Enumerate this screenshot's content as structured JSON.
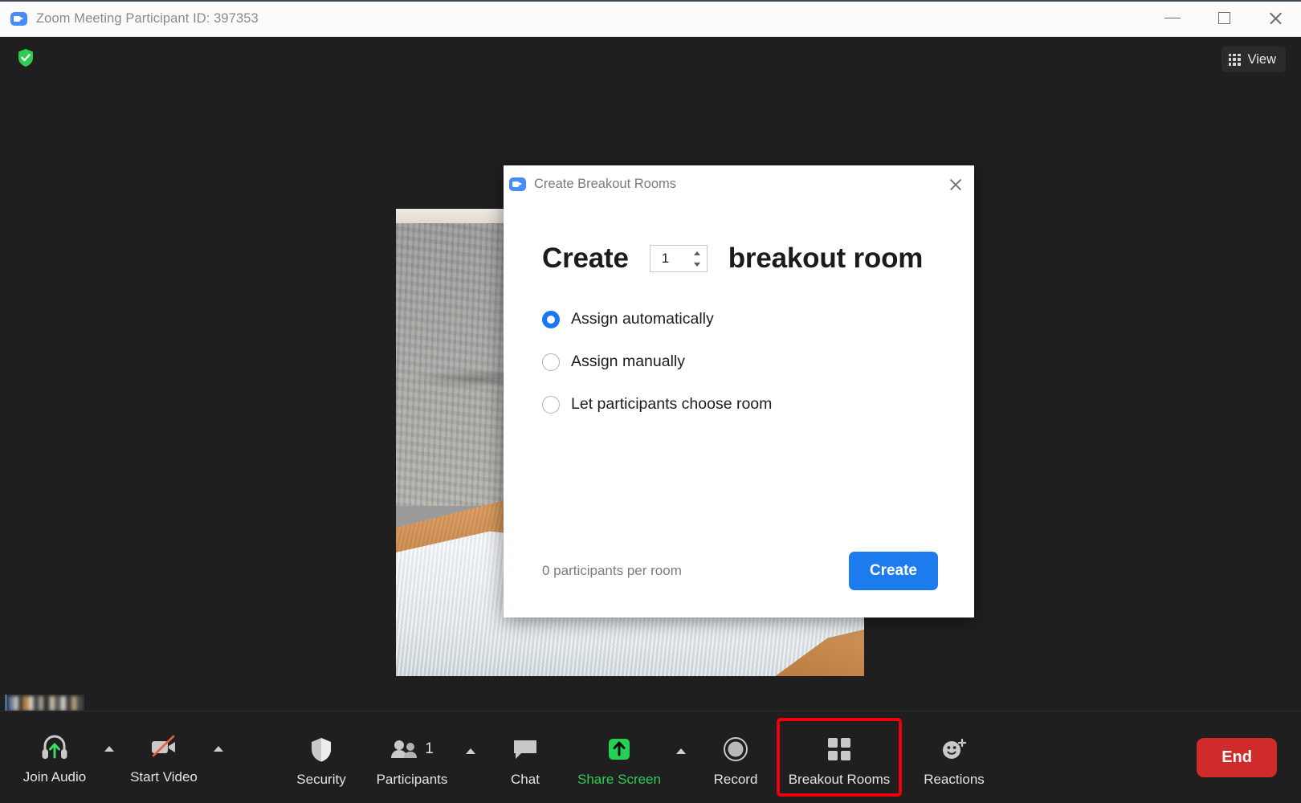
{
  "window": {
    "title": "Zoom Meeting Participant ID: 397353",
    "app_icon": "zoom-camera-icon",
    "controls": {
      "minimize": "minimize-icon",
      "maximize": "maximize-icon",
      "close": "close-icon"
    }
  },
  "stage": {
    "encryption_badge": "green-shield-check-icon",
    "view_button": {
      "label": "View",
      "icon": "grid-view-icon"
    },
    "self_name_label": "(blurred participant name)"
  },
  "dialog": {
    "title": "Create Breakout Rooms",
    "icon": "zoom-camera-icon",
    "close_icon": "close-icon",
    "heading_prefix": "Create",
    "room_count": "1",
    "heading_suffix": "breakout room",
    "spinner": {
      "increment_icon": "chevron-up-icon",
      "decrement_icon": "chevron-down-icon"
    },
    "options": [
      {
        "label": "Assign automatically",
        "selected": true
      },
      {
        "label": "Assign manually",
        "selected": false
      },
      {
        "label": "Let participants choose room",
        "selected": false
      }
    ],
    "footer_note": "0 participants per room",
    "create_button": "Create"
  },
  "toolbar": {
    "items": [
      {
        "label": "Join Audio",
        "icon": "headset-join-audio-icon",
        "caret": true,
        "style": "default"
      },
      {
        "label": "Start Video",
        "icon": "camera-off-icon",
        "caret": true,
        "style": "default"
      },
      {
        "label": "Security",
        "icon": "shield-icon",
        "caret": false,
        "style": "default"
      },
      {
        "label": "Participants",
        "icon": "people-icon",
        "caret": true,
        "style": "default",
        "badge": "1"
      },
      {
        "label": "Chat",
        "icon": "chat-bubble-icon",
        "caret": false,
        "style": "default"
      },
      {
        "label": "Share Screen",
        "icon": "share-screen-arrow-icon",
        "caret": true,
        "style": "green"
      },
      {
        "label": "Record",
        "icon": "record-circle-icon",
        "caret": false,
        "style": "default"
      },
      {
        "label": "Breakout Rooms",
        "icon": "breakout-rooms-grid-icon",
        "caret": false,
        "style": "default",
        "highlighted": true
      },
      {
        "label": "Reactions",
        "icon": "reactions-smiley-plus-icon",
        "caret": false,
        "style": "default"
      }
    ],
    "end_button": "End"
  },
  "colors": {
    "accent_blue": "#1c7ced",
    "radio_blue": "#1877f2",
    "share_green": "#2ecc55",
    "end_red": "#d02b2b",
    "highlight_red": "#f0000d",
    "shield_green": "#2ecc55"
  }
}
